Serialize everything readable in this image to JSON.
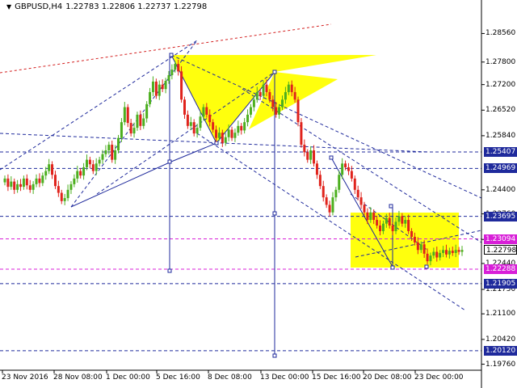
{
  "window": {
    "symbol": "GBPUSD,H4",
    "ohlc": "1.22783 1.22806 1.22737 1.22798",
    "arrow": "▼"
  },
  "colors": {
    "bull": "#4caf1f",
    "bear": "#e0231c",
    "yellow": "#ffff00",
    "blue": "#1f2a9c",
    "magenta": "#d81fd8",
    "red_trend": "#d42020"
  },
  "price_axis": {
    "min": 1.196,
    "max": 1.2915,
    "ticks": [
      "1.28560",
      "1.27800",
      "1.27200",
      "1.26520",
      "1.25840",
      "1.24400",
      "1.23760",
      "1.23080",
      "1.22440",
      "1.21750",
      "1.21100",
      "1.20420",
      "1.19760"
    ]
  },
  "price_labels": [
    {
      "value": "1.25407",
      "price": 1.25407,
      "style": "blue"
    },
    {
      "value": "1.24969",
      "price": 1.24969,
      "style": "blue"
    },
    {
      "value": "1.23695",
      "price": 1.23695,
      "style": "blue"
    },
    {
      "value": "1.23094",
      "price": 1.23094,
      "style": "magenta"
    },
    {
      "value": "1.22798",
      "price": 1.22798,
      "style": "plain"
    },
    {
      "value": "1.22288",
      "price": 1.22288,
      "style": "magenta"
    },
    {
      "value": "1.21905",
      "price": 1.21905,
      "style": "blue"
    },
    {
      "value": "1.20120",
      "price": 1.2012,
      "style": "blue"
    }
  ],
  "time_axis": {
    "labels": [
      "23 Nov 2016",
      "28 Nov 08:00",
      "1 Dec 00:00",
      "5 Dec 16:00",
      "8 Dec 08:00",
      "13 Dec 00:00",
      "15 Dec 16:00",
      "20 Dec 08:00",
      "23 Dec 00:00"
    ]
  },
  "chart_data": {
    "type": "candlestick",
    "title": "GBPUSD,H4",
    "ylim": [
      1.196,
      1.2915
    ],
    "horizontal_levels": [
      1.25407,
      1.24969,
      1.23695,
      1.23094,
      1.22288,
      1.21905,
      1.2012
    ],
    "closes": [
      1.247,
      1.2448,
      1.2462,
      1.244,
      1.2455,
      1.2448,
      1.247,
      1.2452,
      1.244,
      1.2455,
      1.247,
      1.2458,
      1.2478,
      1.249,
      1.2508,
      1.248,
      1.245,
      1.2432,
      1.241,
      1.2418,
      1.244,
      1.2455,
      1.247,
      1.249,
      1.2478,
      1.25,
      1.252,
      1.2508,
      1.249,
      1.251,
      1.252,
      1.2535,
      1.2545,
      1.256,
      1.252,
      1.2545,
      1.2578,
      1.262,
      1.266,
      1.2618,
      1.259,
      1.2605,
      1.264,
      1.261,
      1.263,
      1.2668,
      1.27,
      1.2728,
      1.269,
      1.272,
      1.2708,
      1.273,
      1.2745,
      1.276,
      1.2775,
      1.2755,
      1.268,
      1.264,
      1.261,
      1.262,
      1.259,
      1.2605,
      1.2635,
      1.266,
      1.264,
      1.262,
      1.26,
      1.2578,
      1.2592,
      1.2565,
      1.258,
      1.26,
      1.2578,
      1.2592,
      1.261,
      1.2598,
      1.262,
      1.264,
      1.266,
      1.268,
      1.27,
      1.269,
      1.272,
      1.27,
      1.268,
      1.266,
      1.264,
      1.266,
      1.268,
      1.27,
      1.272,
      1.27,
      1.268,
      1.262,
      1.256,
      1.254,
      1.252,
      1.2545,
      1.251,
      1.248,
      1.245,
      1.242,
      1.24,
      1.238,
      1.242,
      1.244,
      1.248,
      1.251,
      1.25,
      1.249,
      1.247,
      1.244,
      1.242,
      1.24,
      1.238,
      1.236,
      1.238,
      1.236,
      1.2345,
      1.233,
      1.235,
      1.2365,
      1.2345,
      1.233,
      1.2355,
      1.237,
      1.235,
      1.236,
      1.233,
      1.2315,
      1.23,
      1.228,
      1.2295,
      1.227,
      1.225,
      1.2265,
      1.2275,
      1.226,
      1.2272,
      1.228,
      1.2268,
      1.2278,
      1.2272,
      1.228,
      1.2275,
      1.228
    ]
  }
}
